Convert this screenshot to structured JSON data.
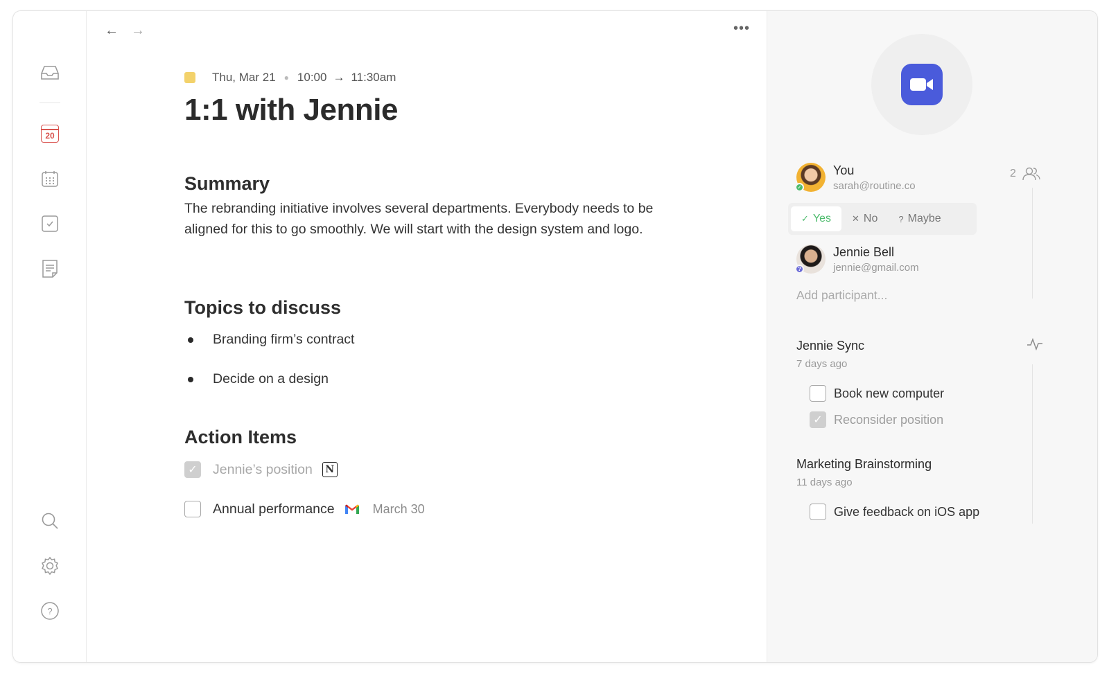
{
  "window": {
    "controls": [
      "close",
      "minimize",
      "maximize"
    ]
  },
  "sidebar": {
    "items": [
      {
        "name": "inbox-icon"
      },
      {
        "name": "today-calendar-icon",
        "label": "20",
        "color": "#d9534f"
      },
      {
        "name": "calendar-grid-icon"
      },
      {
        "name": "tasks-icon"
      },
      {
        "name": "notes-icon"
      }
    ],
    "bottom": [
      {
        "name": "search-icon"
      },
      {
        "name": "settings-icon"
      },
      {
        "name": "help-icon",
        "label": "?"
      }
    ]
  },
  "toolbar": {
    "back": "←",
    "forward": "→",
    "more": "•••"
  },
  "event": {
    "color": "#f3d26b",
    "date": "Thu, Mar 21",
    "start": "10:00",
    "arrow": "→",
    "end": "11:30am",
    "title": "1:1 with Jennie"
  },
  "summary": {
    "heading": "Summary",
    "text": "The rebranding initiative involves several departments. Everybody needs to be aligned for this to go smoothly. We will start with the design system and logo."
  },
  "topics": {
    "heading": "Topics to discuss",
    "items": [
      "Branding firm’s contract",
      "Decide on a design"
    ]
  },
  "actions": {
    "heading": "Action Items",
    "items": [
      {
        "label": "Jennie’s position",
        "checked": true,
        "source": "notion-icon",
        "source_glyph": "N"
      },
      {
        "label": "Annual performance",
        "checked": false,
        "source": "gmail-icon",
        "due": "March 30"
      }
    ]
  },
  "right_panel": {
    "video_icon": "zoom-video-icon",
    "video_color": "#4a5bdb",
    "participants": [
      {
        "name": "You",
        "email": "sarah@routine.co",
        "status": "accepted",
        "status_glyph": "✓"
      },
      {
        "name": "Jennie Bell",
        "email": "jennie@gmail.com",
        "status": "maybe",
        "status_glyph": "?"
      }
    ],
    "participant_count": "2",
    "rsvp": {
      "yes": "Yes",
      "yes_glyph": "✓",
      "no": "No",
      "no_glyph": "✕",
      "maybe": "Maybe",
      "maybe_glyph": "?",
      "selected": "yes"
    },
    "add_participant_placeholder": "Add participant...",
    "related": [
      {
        "title": "Jennie Sync",
        "time": "7 days ago",
        "todos": [
          {
            "label": "Book new computer",
            "checked": false
          },
          {
            "label": "Reconsider position",
            "checked": true
          }
        ]
      },
      {
        "title": "Marketing Brainstorming",
        "time": "11 days ago",
        "todos": [
          {
            "label": "Give feedback on iOS app",
            "checked": false
          }
        ]
      }
    ]
  }
}
